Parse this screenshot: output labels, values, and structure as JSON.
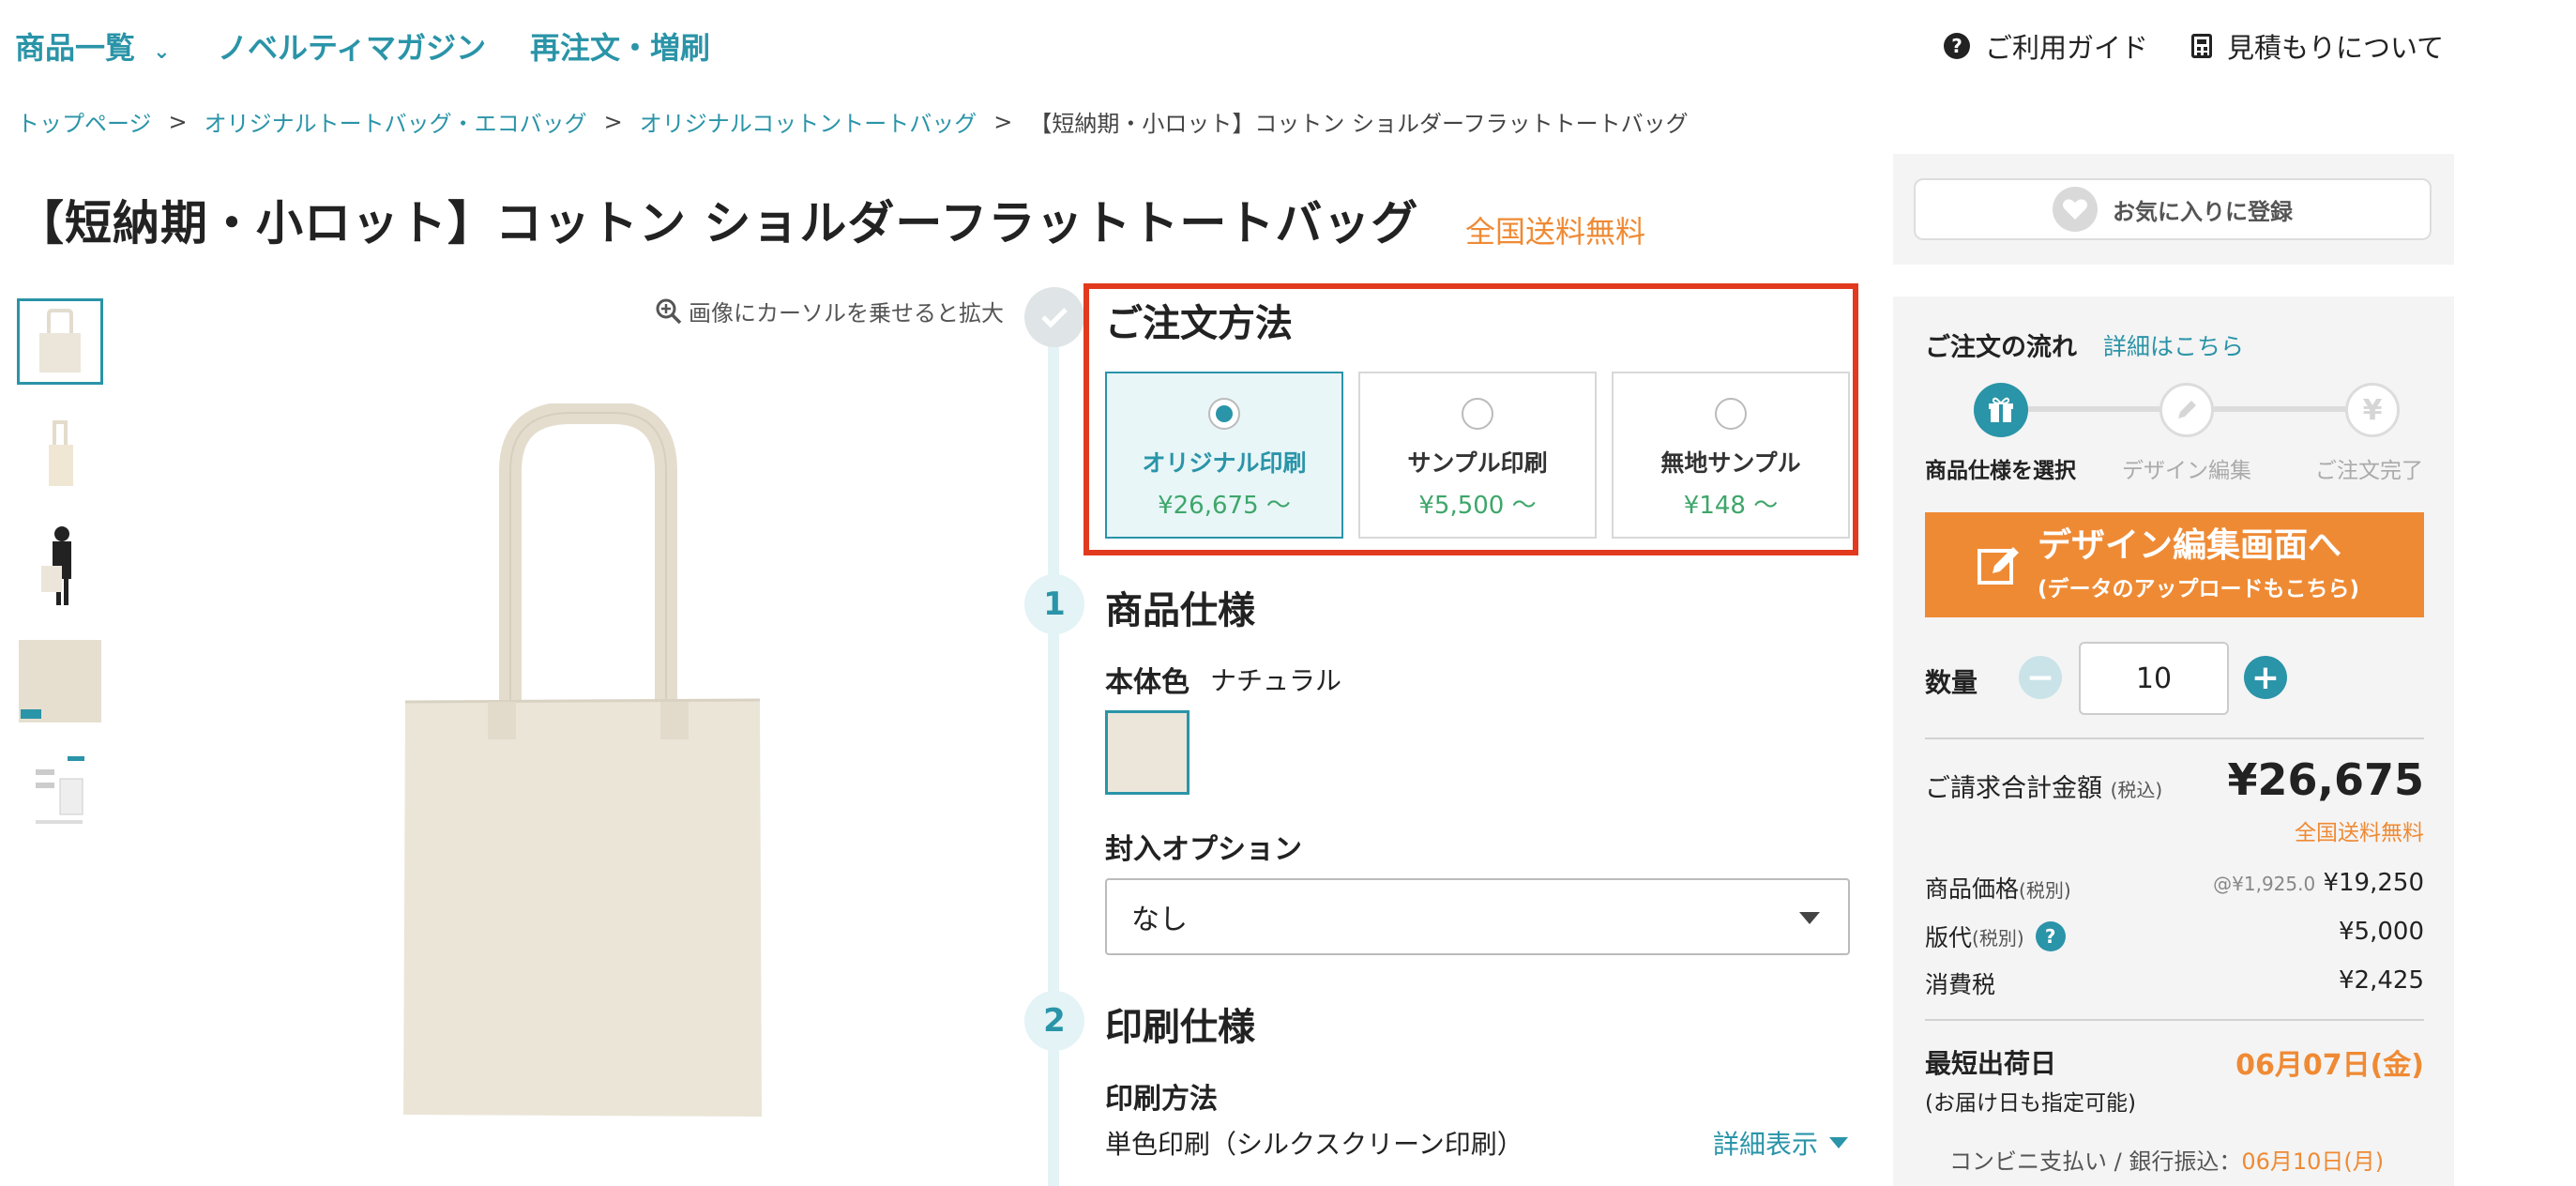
{
  "nav": {
    "products": "商品一覧",
    "magazine": "ノベルティマガジン",
    "reorder": "再注文・増刷",
    "guide": "ご利用ガイド",
    "estimate": "見積もりについて"
  },
  "breadcrumb": {
    "items": [
      "トップページ",
      "オリジナルトートバッグ・エコバッグ",
      "オリジナルコットントートバッグ"
    ],
    "current": "【短納期・小ロット】コットン ショルダーフラットトートバッグ",
    "separator": ">"
  },
  "product": {
    "title": "【短納期・小ロット】コットン ショルダーフラットトートバッグ",
    "free_shipping": "全国送料無料",
    "zoom_hint": "画像にカーソルを乗せると拡大"
  },
  "order_method": {
    "heading": "ご注文方法",
    "options": [
      {
        "label": "オリジナル印刷",
        "price": "¥26,675 〜",
        "selected": true
      },
      {
        "label": "サンプル印刷",
        "price": "¥5,500 〜",
        "selected": false
      },
      {
        "label": "無地サンプル",
        "price": "¥148 〜",
        "selected": false
      }
    ]
  },
  "spec": {
    "step_num": "1",
    "heading": "商品仕様",
    "color_label": "本体色",
    "color_value": "ナチュラル",
    "swatch_color": "#ece6da",
    "enclosure_label": "封入オプション",
    "enclosure_value": "なし"
  },
  "print": {
    "step_num": "2",
    "heading": "印刷仕様",
    "method_label": "印刷方法",
    "method_value": "単色印刷（シルクスクリーン印刷）",
    "detail_link": "詳細表示"
  },
  "sidebar": {
    "favorite": "お気に入りに登録",
    "flow_title": "ご注文の流れ",
    "flow_link": "詳細はこちら",
    "flow_steps": [
      "商品仕様を選択",
      "デザイン編集",
      "ご注文完了"
    ],
    "cta_main": "デザイン編集画面へ",
    "cta_sub": "(データのアップロードもこちら)",
    "qty_label": "数量",
    "qty_value": "10",
    "total_label": "ご請求合計金額",
    "total_tax": "(税込)",
    "total_value": "¥26,675",
    "total_note": "全国送料無料",
    "price_label": "商品価格",
    "price_tax": "(税別)",
    "price_unit": "@¥1,925.0",
    "price_value": "¥19,250",
    "plate_label": "版代",
    "plate_tax": "(税別)",
    "plate_value": "¥5,000",
    "tax_label": "消費税",
    "tax_value": "¥2,425",
    "ship_label": "最短出荷日",
    "ship_note": "(お届け日も指定可能)",
    "ship_date": "06月07日(金)",
    "payment_label": "コンビニ支払い / 銀行振込：",
    "payment_date": "06月10日(月)"
  },
  "colors": {
    "accent": "#2a94a8",
    "orange": "#ef8a34",
    "price_green": "#3ea66a",
    "highlight_red": "#e23a1e"
  }
}
